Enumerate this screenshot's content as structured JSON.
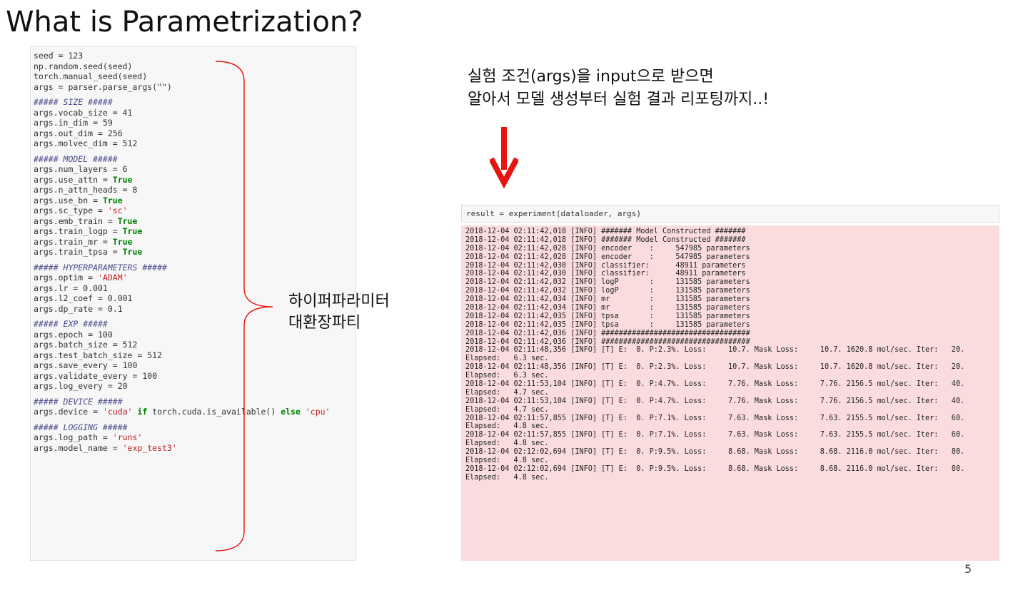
{
  "title": "What is Parametrization?",
  "page_number": "5",
  "brace_label": [
    "하이퍼파라미터",
    "대환장파티"
  ],
  "annotation": [
    "실험 조건(args)을 input으로 받으면",
    "알아서 모델 생성부터 실험 결과 리포팅까지..!"
  ],
  "colors": {
    "arrow": "#e8140f",
    "output_bg": "#fadcdc",
    "keyword_true": "#008000",
    "string": "#ba2121"
  },
  "code_lines": [
    [
      {
        "t": "seed = 123"
      }
    ],
    [
      {
        "t": "np.random.seed(seed)"
      }
    ],
    [
      {
        "t": "torch.manual_seed(seed)"
      }
    ],
    [
      {
        "t": "args = parser.parse_args(\"\")"
      }
    ],
    [],
    [
      {
        "t": "##### SIZE #####",
        "c": "cmt"
      }
    ],
    [
      {
        "t": "args.vocab_size = 41"
      }
    ],
    [
      {
        "t": "args.in_dim = 59"
      }
    ],
    [
      {
        "t": "args.out_dim = 256"
      }
    ],
    [
      {
        "t": "args.molvec_dim = 512"
      }
    ],
    [],
    [
      {
        "t": "##### MODEL #####",
        "c": "cmt"
      }
    ],
    [
      {
        "t": "args.num_layers = 6"
      }
    ],
    [
      {
        "t": "args.use_attn = "
      },
      {
        "t": "True",
        "c": "kw"
      }
    ],
    [
      {
        "t": "args.n_attn_heads = 8"
      }
    ],
    [
      {
        "t": "args.use_bn = "
      },
      {
        "t": "True",
        "c": "kw"
      }
    ],
    [
      {
        "t": "args.sc_type = "
      },
      {
        "t": "'sc'",
        "c": "str"
      }
    ],
    [
      {
        "t": "args.emb_train = "
      },
      {
        "t": "True",
        "c": "kw"
      }
    ],
    [
      {
        "t": "args.train_logp = "
      },
      {
        "t": "True",
        "c": "kw"
      }
    ],
    [
      {
        "t": "args.train_mr = "
      },
      {
        "t": "True",
        "c": "kw"
      }
    ],
    [
      {
        "t": "args.train_tpsa = "
      },
      {
        "t": "True",
        "c": "kw"
      }
    ],
    [],
    [
      {
        "t": "##### HYPERPARAMETERS #####",
        "c": "cmt"
      }
    ],
    [
      {
        "t": "args.optim = "
      },
      {
        "t": "'ADAM'",
        "c": "str"
      }
    ],
    [
      {
        "t": "args.lr = 0.001"
      }
    ],
    [
      {
        "t": "args.l2_coef = 0.001"
      }
    ],
    [
      {
        "t": "args.dp_rate = 0.1"
      }
    ],
    [],
    [
      {
        "t": "##### EXP #####",
        "c": "cmt"
      }
    ],
    [
      {
        "t": "args.epoch = 100"
      }
    ],
    [
      {
        "t": "args.batch_size = 512"
      }
    ],
    [
      {
        "t": "args.test_batch_size = 512"
      }
    ],
    [
      {
        "t": "args.save_every = 100"
      }
    ],
    [
      {
        "t": "args.validate_every = 100"
      }
    ],
    [
      {
        "t": "args.log_every = 20"
      }
    ],
    [],
    [
      {
        "t": "##### DEVICE #####",
        "c": "cmt"
      }
    ],
    [
      {
        "t": "args.device = "
      },
      {
        "t": "'cuda'",
        "c": "str"
      },
      {
        "t": " if",
        "c": "kw"
      },
      {
        "t": " torch.cuda.is_available() "
      },
      {
        "t": "else",
        "c": "kw"
      },
      {
        "t": " "
      },
      {
        "t": "'cpu'",
        "c": "str"
      }
    ],
    [],
    [
      {
        "t": "##### LOGGING #####",
        "c": "cmt"
      }
    ],
    [
      {
        "t": "args.log_path = "
      },
      {
        "t": "'runs'",
        "c": "str"
      }
    ],
    [
      {
        "t": "args.model_name = "
      },
      {
        "t": "'exp_test3'",
        "c": "str"
      }
    ]
  ],
  "command": "result = experiment(dataloader, args)",
  "output_lines": [
    "2018-12-04 02:11:42,018 [INFO] ####### Model Constructed #######",
    "2018-12-04 02:11:42,018 [INFO] ####### Model Constructed #######",
    "2018-12-04 02:11:42,028 [INFO] encoder    :     547985 parameters",
    "2018-12-04 02:11:42,028 [INFO] encoder    :     547985 parameters",
    "2018-12-04 02:11:42,030 [INFO] classifier:      48911 parameters",
    "2018-12-04 02:11:42,030 [INFO] classifier:      48911 parameters",
    "2018-12-04 02:11:42,032 [INFO] logP       :     131585 parameters",
    "2018-12-04 02:11:42,032 [INFO] logP       :     131585 parameters",
    "2018-12-04 02:11:42,034 [INFO] mr         :     131585 parameters",
    "2018-12-04 02:11:42,034 [INFO] mr         :     131585 parameters",
    "2018-12-04 02:11:42,035 [INFO] tpsa       :     131585 parameters",
    "2018-12-04 02:11:42,035 [INFO] tpsa       :     131585 parameters",
    "2018-12-04 02:11:42,036 [INFO] ##################################",
    "2018-12-04 02:11:42,036 [INFO] ##################################",
    "2018-12-04 02:11:48,356 [INFO] [T] E:  0. P:2.3%. Loss:     10.7. Mask Loss:     10.7. 1620.8 mol/sec. Iter:   20.",
    "Elapsed:   6.3 sec.",
    "2018-12-04 02:11:48,356 [INFO] [T] E:  0. P:2.3%. Loss:     10.7. Mask Loss:     10.7. 1620.8 mol/sec. Iter:   20.",
    "Elapsed:   6.3 sec.",
    "2018-12-04 02:11:53,104 [INFO] [T] E:  0. P:4.7%. Loss:     7.76. Mask Loss:     7.76. 2156.5 mol/sec. Iter:   40.",
    "Elapsed:   4.7 sec.",
    "2018-12-04 02:11:53,104 [INFO] [T] E:  0. P:4.7%. Loss:     7.76. Mask Loss:     7.76. 2156.5 mol/sec. Iter:   40.",
    "Elapsed:   4.7 sec.",
    "2018-12-04 02:11:57,855 [INFO] [T] E:  0. P:7.1%. Loss:     7.63. Mask Loss:     7.63. 2155.5 mol/sec. Iter:   60.",
    "Elapsed:   4.8 sec.",
    "2018-12-04 02:11:57,855 [INFO] [T] E:  0. P:7.1%. Loss:     7.63. Mask Loss:     7.63. 2155.5 mol/sec. Iter:   60.",
    "Elapsed:   4.8 sec.",
    "2018-12-04 02:12:02,694 [INFO] [T] E:  0. P:9.5%. Loss:     8.68. Mask Loss:     8.68. 2116.0 mol/sec. Iter:   80.",
    "Elapsed:   4.8 sec.",
    "2018-12-04 02:12:02,694 [INFO] [T] E:  0. P:9.5%. Loss:     8.68. Mask Loss:     8.68. 2116.0 mol/sec. Iter:   80.",
    "Elapsed:   4.8 sec."
  ]
}
